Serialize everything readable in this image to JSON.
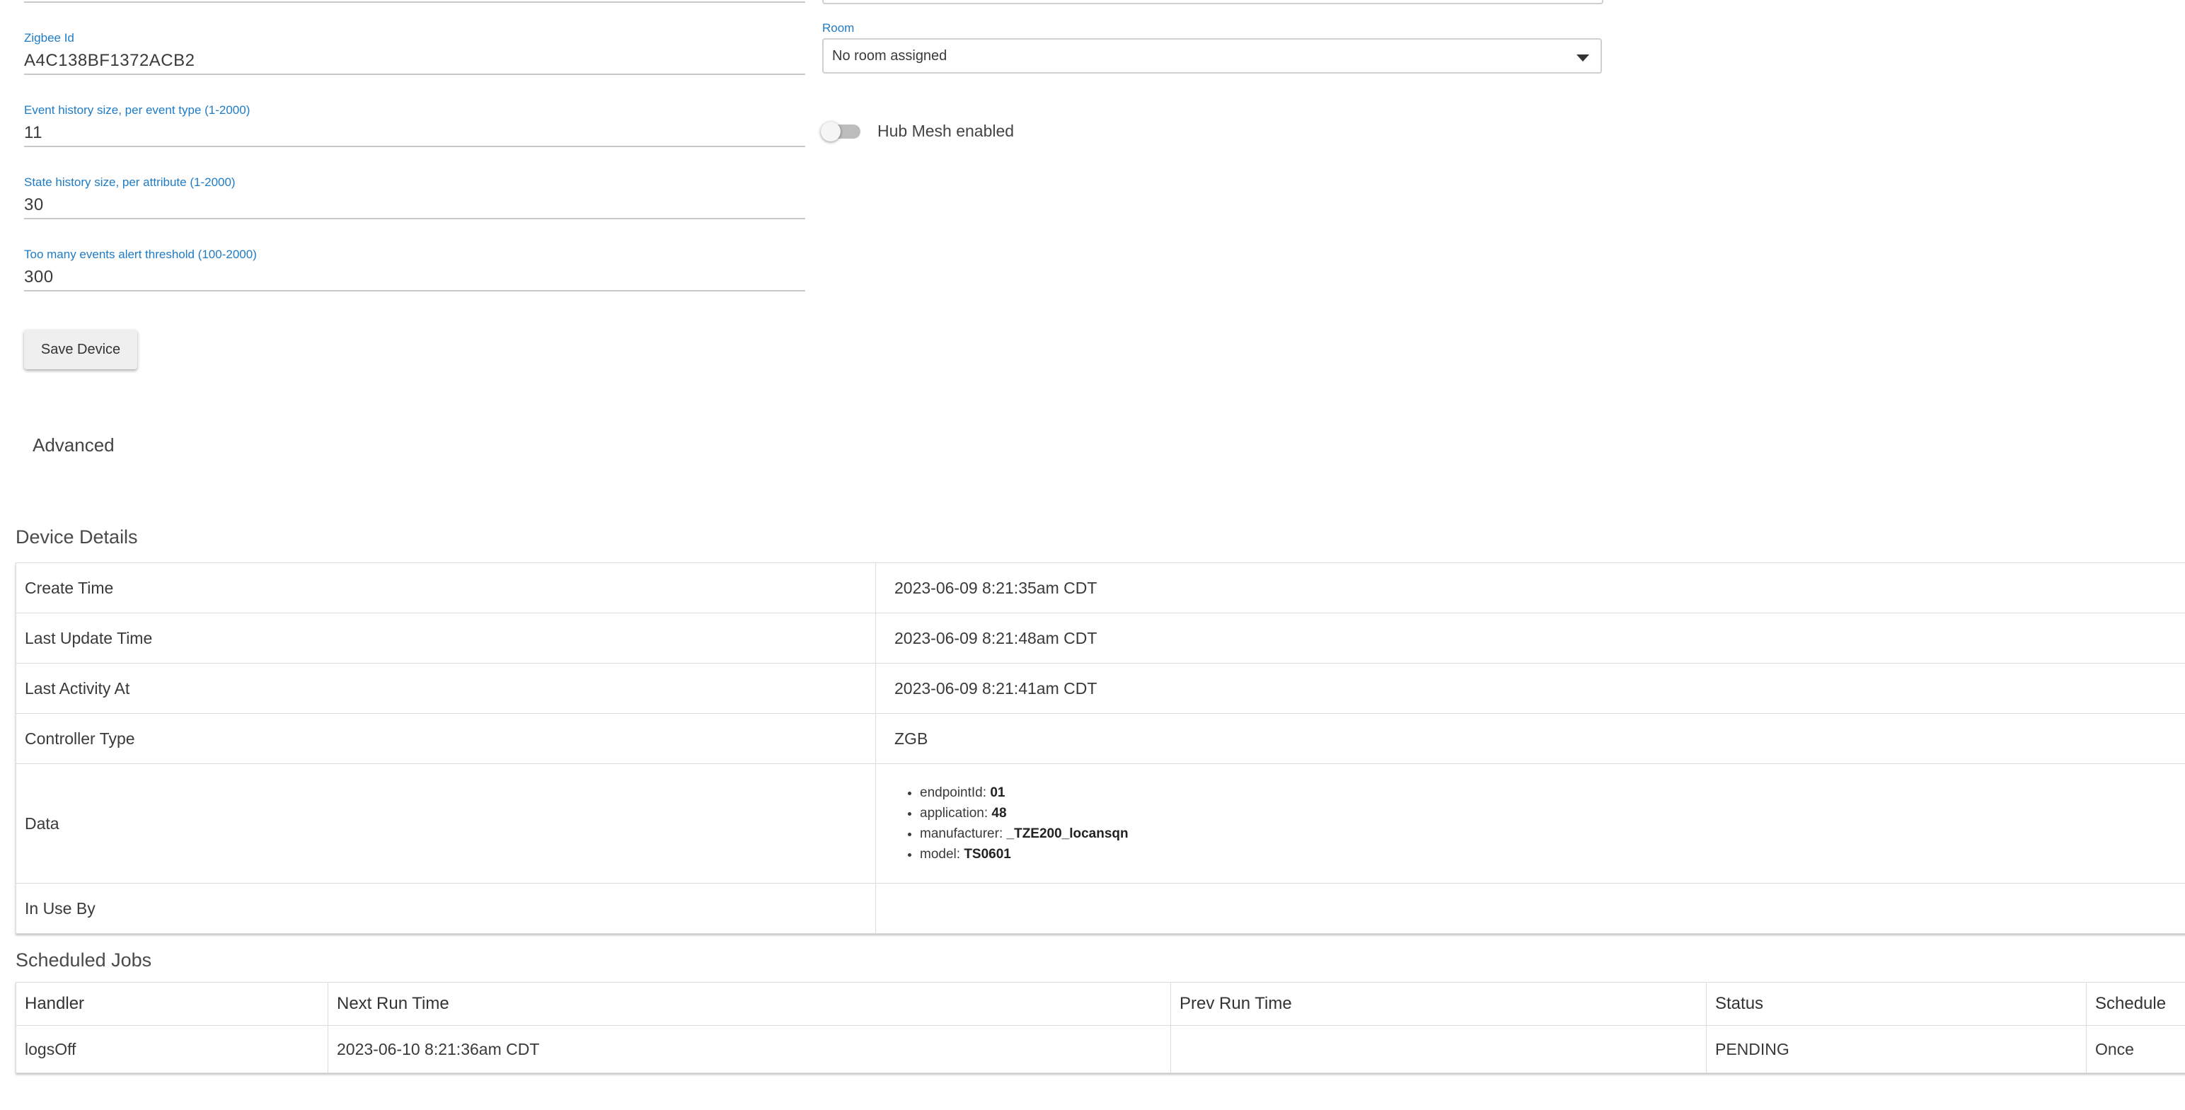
{
  "fields": {
    "zigbee_id": {
      "label": "Zigbee Id",
      "value": "A4C138BF1372ACB2"
    },
    "event_history": {
      "label": "Event history size, per event type (1-2000)",
      "value": "11"
    },
    "state_history": {
      "label": "State history size, per attribute (1-2000)",
      "value": "30"
    },
    "too_many_events": {
      "label": "Too many events alert threshold (100-2000)",
      "value": "300"
    }
  },
  "room": {
    "label": "Room",
    "selected": "No room assigned"
  },
  "hub_mesh": {
    "label": "Hub Mesh enabled",
    "enabled": false
  },
  "save_button": "Save Device",
  "advanced_label": "Advanced",
  "device_details": {
    "title": "Device Details",
    "rows": [
      {
        "key": "Create Time",
        "value": "2023-06-09 8:21:35am CDT"
      },
      {
        "key": "Last Update Time",
        "value": "2023-06-09 8:21:48am CDT"
      },
      {
        "key": "Last Activity At",
        "value": "2023-06-09 8:21:41am CDT"
      },
      {
        "key": "Controller Type",
        "value": "ZGB"
      },
      {
        "key": "Data"
      },
      {
        "key": "In Use By",
        "value": ""
      }
    ],
    "data_items": [
      {
        "name": "endpointId:",
        "value": "01"
      },
      {
        "name": "application:",
        "value": "48"
      },
      {
        "name": "manufacturer:",
        "value": "_TZE200_locansqn"
      },
      {
        "name": "model:",
        "value": "TS0601"
      }
    ]
  },
  "scheduled_jobs": {
    "title": "Scheduled Jobs",
    "columns": [
      "Handler",
      "Next Run Time",
      "Prev Run Time",
      "Status",
      "Schedule"
    ],
    "rows": [
      {
        "handler": "logsOff",
        "next_run": "2023-06-10 8:21:36am CDT",
        "prev_run": "",
        "status": "PENDING",
        "schedule": "Once"
      }
    ]
  }
}
